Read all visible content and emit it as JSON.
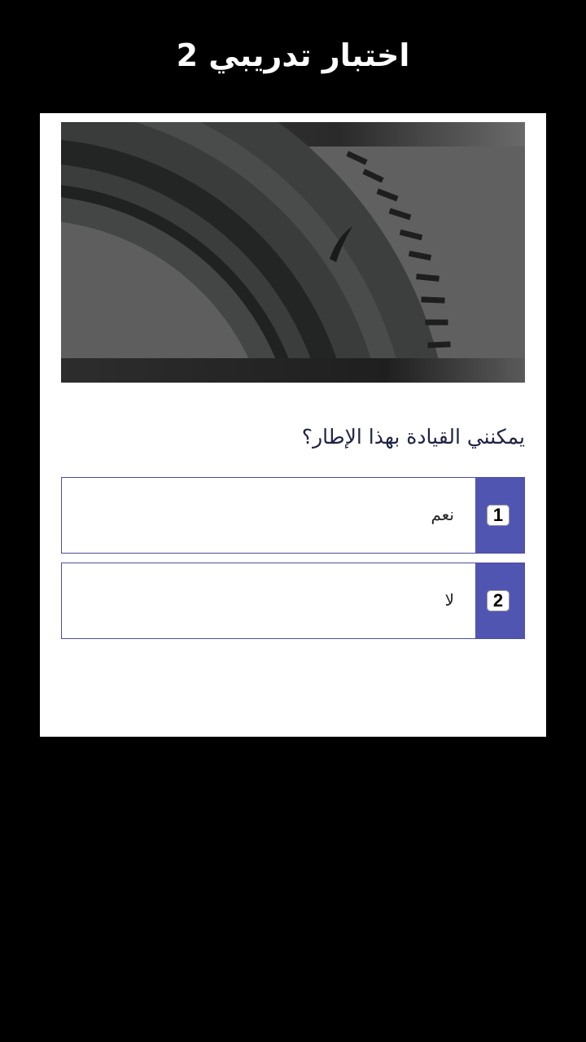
{
  "header": {
    "title": "اختبار تدريبي 2"
  },
  "question": {
    "text": "يمكنني القيادة بهذا الإطار؟",
    "image_icon": "tire-image"
  },
  "answers": [
    {
      "number": "1",
      "label": "نعم"
    },
    {
      "number": "2",
      "label": "لا"
    }
  ],
  "colors": {
    "background": "#000000",
    "card": "#ffffff",
    "accent": "#5055b2",
    "border": "#4b4f9a",
    "question_text": "#1f2342"
  }
}
